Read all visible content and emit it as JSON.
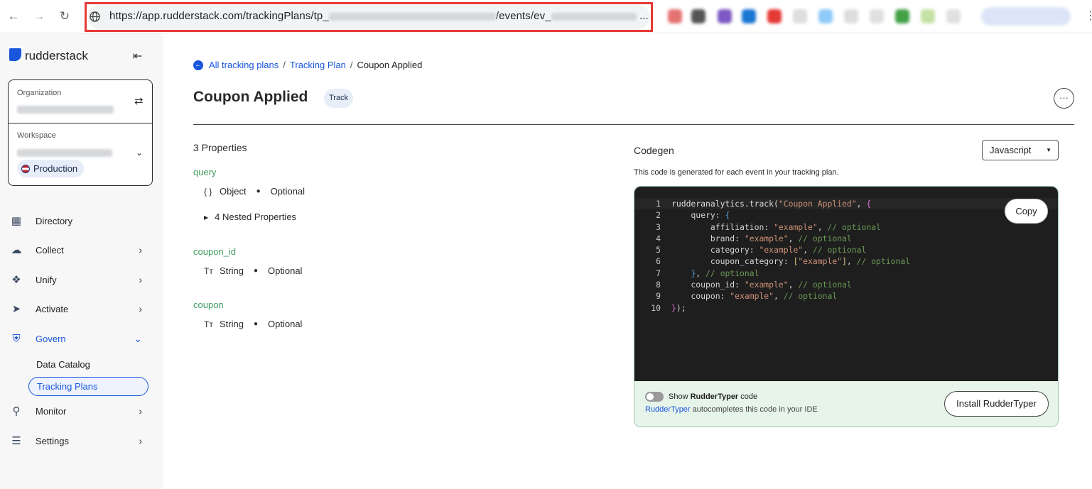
{
  "browser": {
    "url_prefix": "https://app.rudderstack.com/trackingPlans/tp_",
    "url_middle": "/events/ev_",
    "url_suffix": "..."
  },
  "sidebar": {
    "logo": "rudderstack",
    "organization_label": "Organization",
    "workspace_label": "Workspace",
    "environment": "Production",
    "items": [
      {
        "label": "Directory",
        "icon": "directory-icon"
      },
      {
        "label": "Collect",
        "icon": "collect-icon"
      },
      {
        "label": "Unify",
        "icon": "unify-icon"
      },
      {
        "label": "Activate",
        "icon": "activate-icon"
      },
      {
        "label": "Govern",
        "icon": "govern-icon"
      },
      {
        "label": "Monitor",
        "icon": "monitor-icon"
      },
      {
        "label": "Settings",
        "icon": "settings-icon"
      }
    ],
    "govern_sub": [
      "Data Catalog",
      "Tracking Plans"
    ]
  },
  "breadcrumb": {
    "all_plans": "All tracking plans",
    "plan": "Tracking Plan",
    "current": "Coupon Applied"
  },
  "event": {
    "title": "Coupon Applied",
    "type_badge": "Track"
  },
  "properties": {
    "count_label": "3 Properties",
    "items": [
      {
        "name": "query",
        "type": "Object",
        "required": "Optional",
        "nested": "4 Nested Properties"
      },
      {
        "name": "coupon_id",
        "type": "String",
        "required": "Optional"
      },
      {
        "name": "coupon",
        "type": "String",
        "required": "Optional"
      }
    ]
  },
  "codegen": {
    "title": "Codegen",
    "description": "This code is generated for each event in your tracking plan.",
    "language": "Javascript",
    "copy_label": "Copy",
    "line_numbers": [
      "1",
      "2",
      "3",
      "4",
      "5",
      "6",
      "7",
      "8",
      "9",
      "10"
    ],
    "show_label_prefix": "Show ",
    "show_label_bold": "RudderTyper",
    "show_label_suffix": " code",
    "rudder_link": "RudderTyper",
    "rudder_sub": " autocompletes this code in your IDE",
    "install_label": "Install RudderTyper",
    "code": {
      "l1_fn": "rudderanalytics.track(",
      "l1_str": "\"Coupon Applied\"",
      "l1_tail": ", ",
      "l1_brace": "{",
      "l2_key": "    query: ",
      "l2_brace": "{",
      "l3_key": "        affiliation: ",
      "l4_key": "        brand: ",
      "l5_key": "        category: ",
      "l6_key": "        coupon_category: ",
      "l6_open": "[",
      "l6_close": "]",
      "str_example": "\"example\"",
      "comma": ", ",
      "comment": "// optional",
      "l7_pad": "    ",
      "l7_brace": "}",
      "l8_key": "    coupon_id: ",
      "l9_key": "    coupon: ",
      "l10_brace": "}",
      "l10_tail": ");"
    }
  }
}
